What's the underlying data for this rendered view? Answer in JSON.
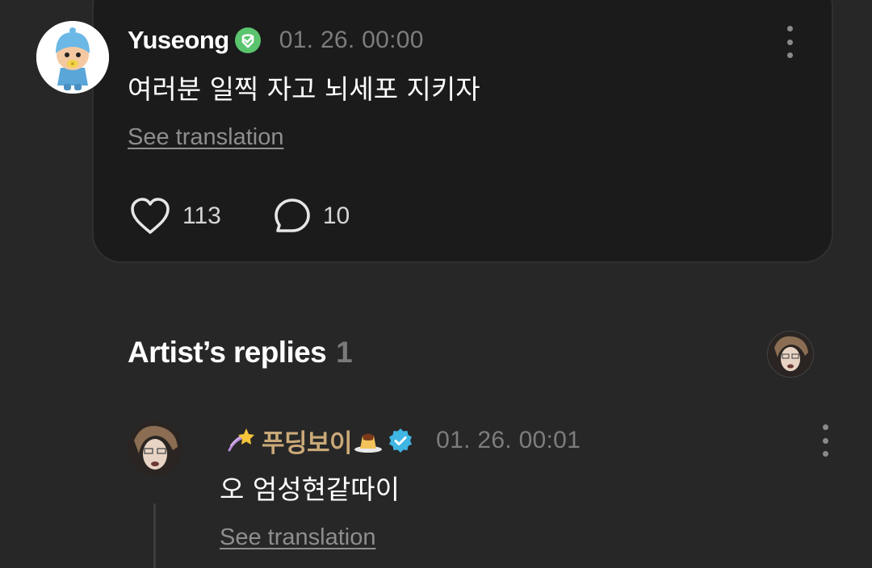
{
  "post": {
    "author": "Yuseong",
    "timestamp": "01. 26. 00:00",
    "text": "여러분 일찍 자고 뇌세포 지키자",
    "see_translation": "See translation",
    "likes": "113",
    "comments": "10",
    "avatar_icon": "pocoyo-avatar"
  },
  "artist_replies": {
    "title": "Artist’s replies",
    "count": "1"
  },
  "reply": {
    "author": "푸딩보이",
    "timestamp": "01. 26. 00:01",
    "text": "오 엄성현같따이",
    "see_translation": "See translation"
  },
  "colors": {
    "background": "#272727",
    "card": "#1b1b1b",
    "verified_green": "#5bc46e",
    "verified_blue": "#3fb6e4",
    "artist_name": "#caa978",
    "muted": "#7d7d7d"
  }
}
